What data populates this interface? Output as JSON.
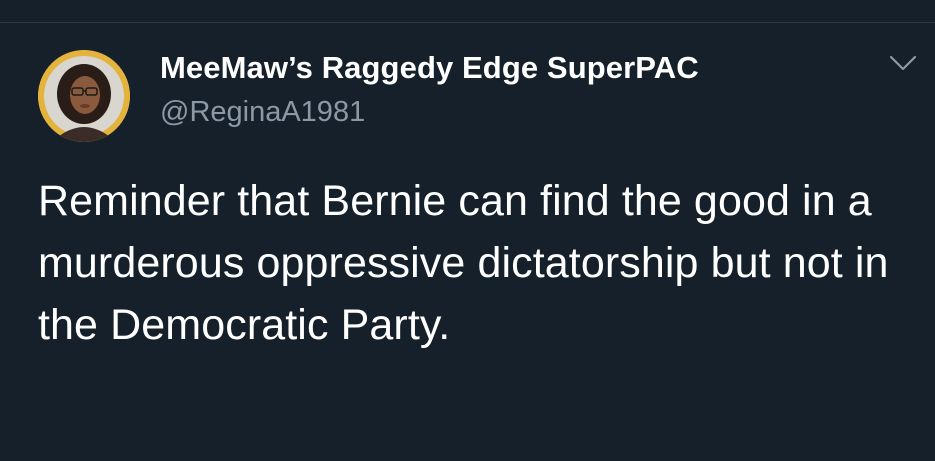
{
  "tweet": {
    "author": {
      "display_name": "MeeMaw’s Raggedy Edge SuperPAC",
      "handle": "@ReginaA1981",
      "avatar_icon": "profile-photo-avatar"
    },
    "menu_icon": "chevron-down-icon",
    "text": "Reminder that Bernie can find the good in a murderous oppressive dictatorship but not in the Democratic Party."
  },
  "colors": {
    "background": "#15202b",
    "text_primary": "#ffffff",
    "text_secondary": "#8b98a5",
    "avatar_ring": "#e3b33d"
  }
}
